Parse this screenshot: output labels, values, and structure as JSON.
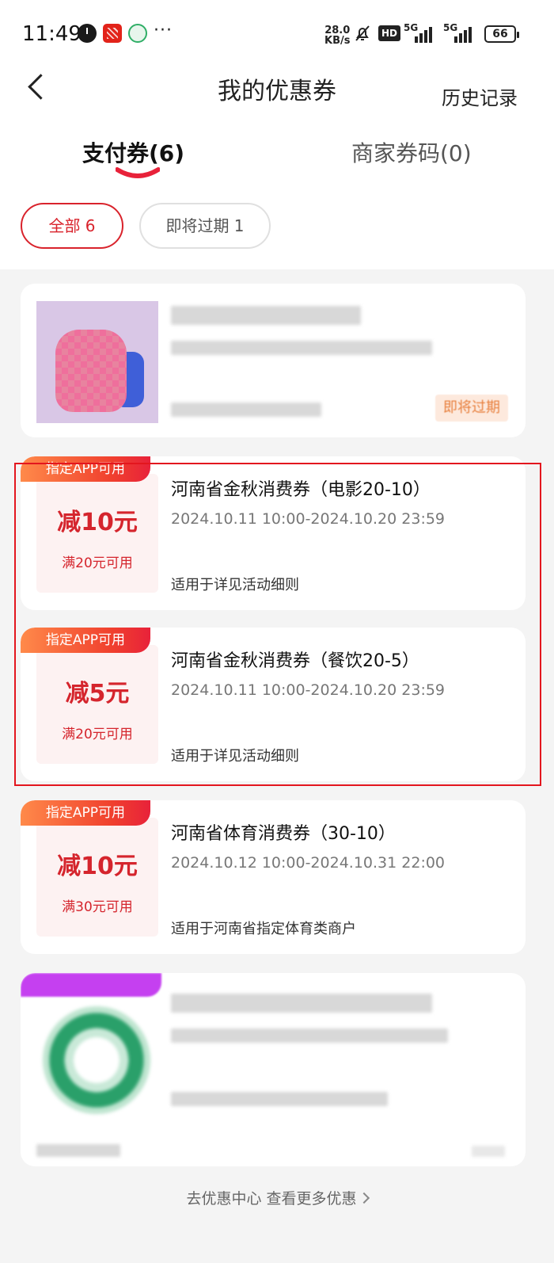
{
  "status_bar": {
    "time": "11:49",
    "net_speed_value": "28.0",
    "net_speed_unit": "KB/s",
    "hd_label": "HD",
    "signal_1_label": "5G",
    "signal_2_label": "5G",
    "battery": "66",
    "icons": [
      "clock-icon",
      "app-icon",
      "leaf-icon",
      "more-icon",
      "bell-off-icon",
      "hd-icon",
      "signal-icon",
      "battery-icon"
    ]
  },
  "header": {
    "back_icon": "chevron-left-icon",
    "title": "我的优惠券",
    "history_label": "历史记录"
  },
  "tabs": [
    {
      "label": "支付券(6)",
      "active": true
    },
    {
      "label": "商家券码(0)",
      "active": false
    }
  ],
  "filters": [
    {
      "label": "全部 6",
      "active": true
    },
    {
      "label": "即将过期 1",
      "active": false
    }
  ],
  "blurred_card_1": {
    "badge": "即将过期"
  },
  "coupons": [
    {
      "tag": "指定APP可用",
      "amount": "减10元",
      "threshold": "满20元可用",
      "title": "河南省金秋消费券（电影20-10）",
      "time_range": "2024.10.11 10:00-2024.10.20 23:59",
      "scope": "适用于详见活动细则"
    },
    {
      "tag": "指定APP可用",
      "amount": "减5元",
      "threshold": "满20元可用",
      "title": "河南省金秋消费券（餐饮20-5）",
      "time_range": "2024.10.11 10:00-2024.10.20 23:59",
      "scope": "适用于详见活动细则"
    },
    {
      "tag": "指定APP可用",
      "amount": "减10元",
      "threshold": "满30元可用",
      "title": "河南省体育消费券（30-10）",
      "time_range": "2024.10.12 10:00-2024.10.31 22:00",
      "scope": "适用于河南省指定体育类商户"
    }
  ],
  "footer": {
    "link": "去优惠中心 查看更多优惠"
  },
  "colors": {
    "brand_red": "#d5252d",
    "tag_gradient_start": "#ff8a4a",
    "tag_gradient_end": "#e8223a",
    "highlight_box": "#e3161e",
    "page_bg": "#f4f4f4"
  }
}
